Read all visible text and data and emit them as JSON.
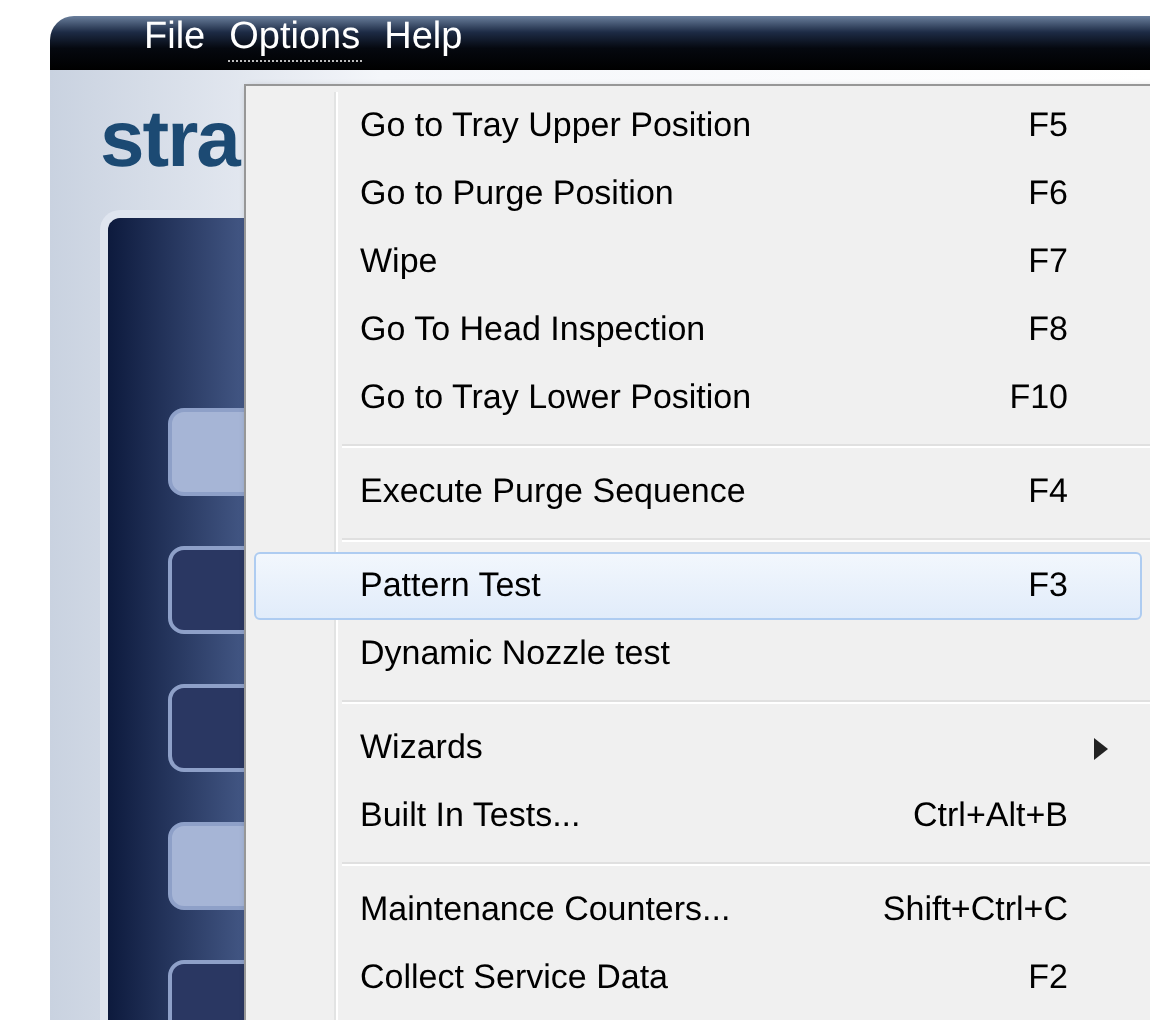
{
  "menu_bar": [
    {
      "label": "File",
      "selected": false
    },
    {
      "label": "Options",
      "selected": true
    },
    {
      "label": "Help",
      "selected": false
    }
  ],
  "logo": {
    "text": "stra"
  },
  "side_buttons": [
    {
      "highlighted": true
    },
    {
      "highlighted": false
    },
    {
      "highlighted": false
    },
    {
      "highlighted": true
    },
    {
      "highlighted": false
    }
  ],
  "options_menu": [
    {
      "kind": "item",
      "label": "Go to Tray Upper Position",
      "shortcut": "F5",
      "selected": false
    },
    {
      "kind": "item",
      "label": "Go to Purge Position",
      "shortcut": "F6",
      "selected": false
    },
    {
      "kind": "item",
      "label": "Wipe",
      "shortcut": "F7",
      "selected": false
    },
    {
      "kind": "item",
      "label": "Go To Head Inspection",
      "shortcut": "F8",
      "selected": false
    },
    {
      "kind": "item",
      "label": "Go to Tray Lower Position",
      "shortcut": "F10",
      "selected": false
    },
    {
      "kind": "separator"
    },
    {
      "kind": "item",
      "label": "Execute Purge Sequence",
      "shortcut": "F4",
      "selected": false
    },
    {
      "kind": "separator"
    },
    {
      "kind": "item",
      "label": "Pattern Test",
      "shortcut": "F3",
      "selected": true
    },
    {
      "kind": "item",
      "label": "Dynamic Nozzle test",
      "selected": false
    },
    {
      "kind": "separator"
    },
    {
      "kind": "submenu",
      "label": "Wizards",
      "selected": false
    },
    {
      "kind": "item",
      "label": "Built In Tests...",
      "shortcut": "Ctrl+Alt+B",
      "selected": false
    },
    {
      "kind": "separator"
    },
    {
      "kind": "item",
      "label": "Maintenance Counters...",
      "shortcut": "Shift+Ctrl+C",
      "selected": false
    },
    {
      "kind": "item",
      "label": "Collect Service Data",
      "shortcut": "F2",
      "selected": false
    }
  ]
}
